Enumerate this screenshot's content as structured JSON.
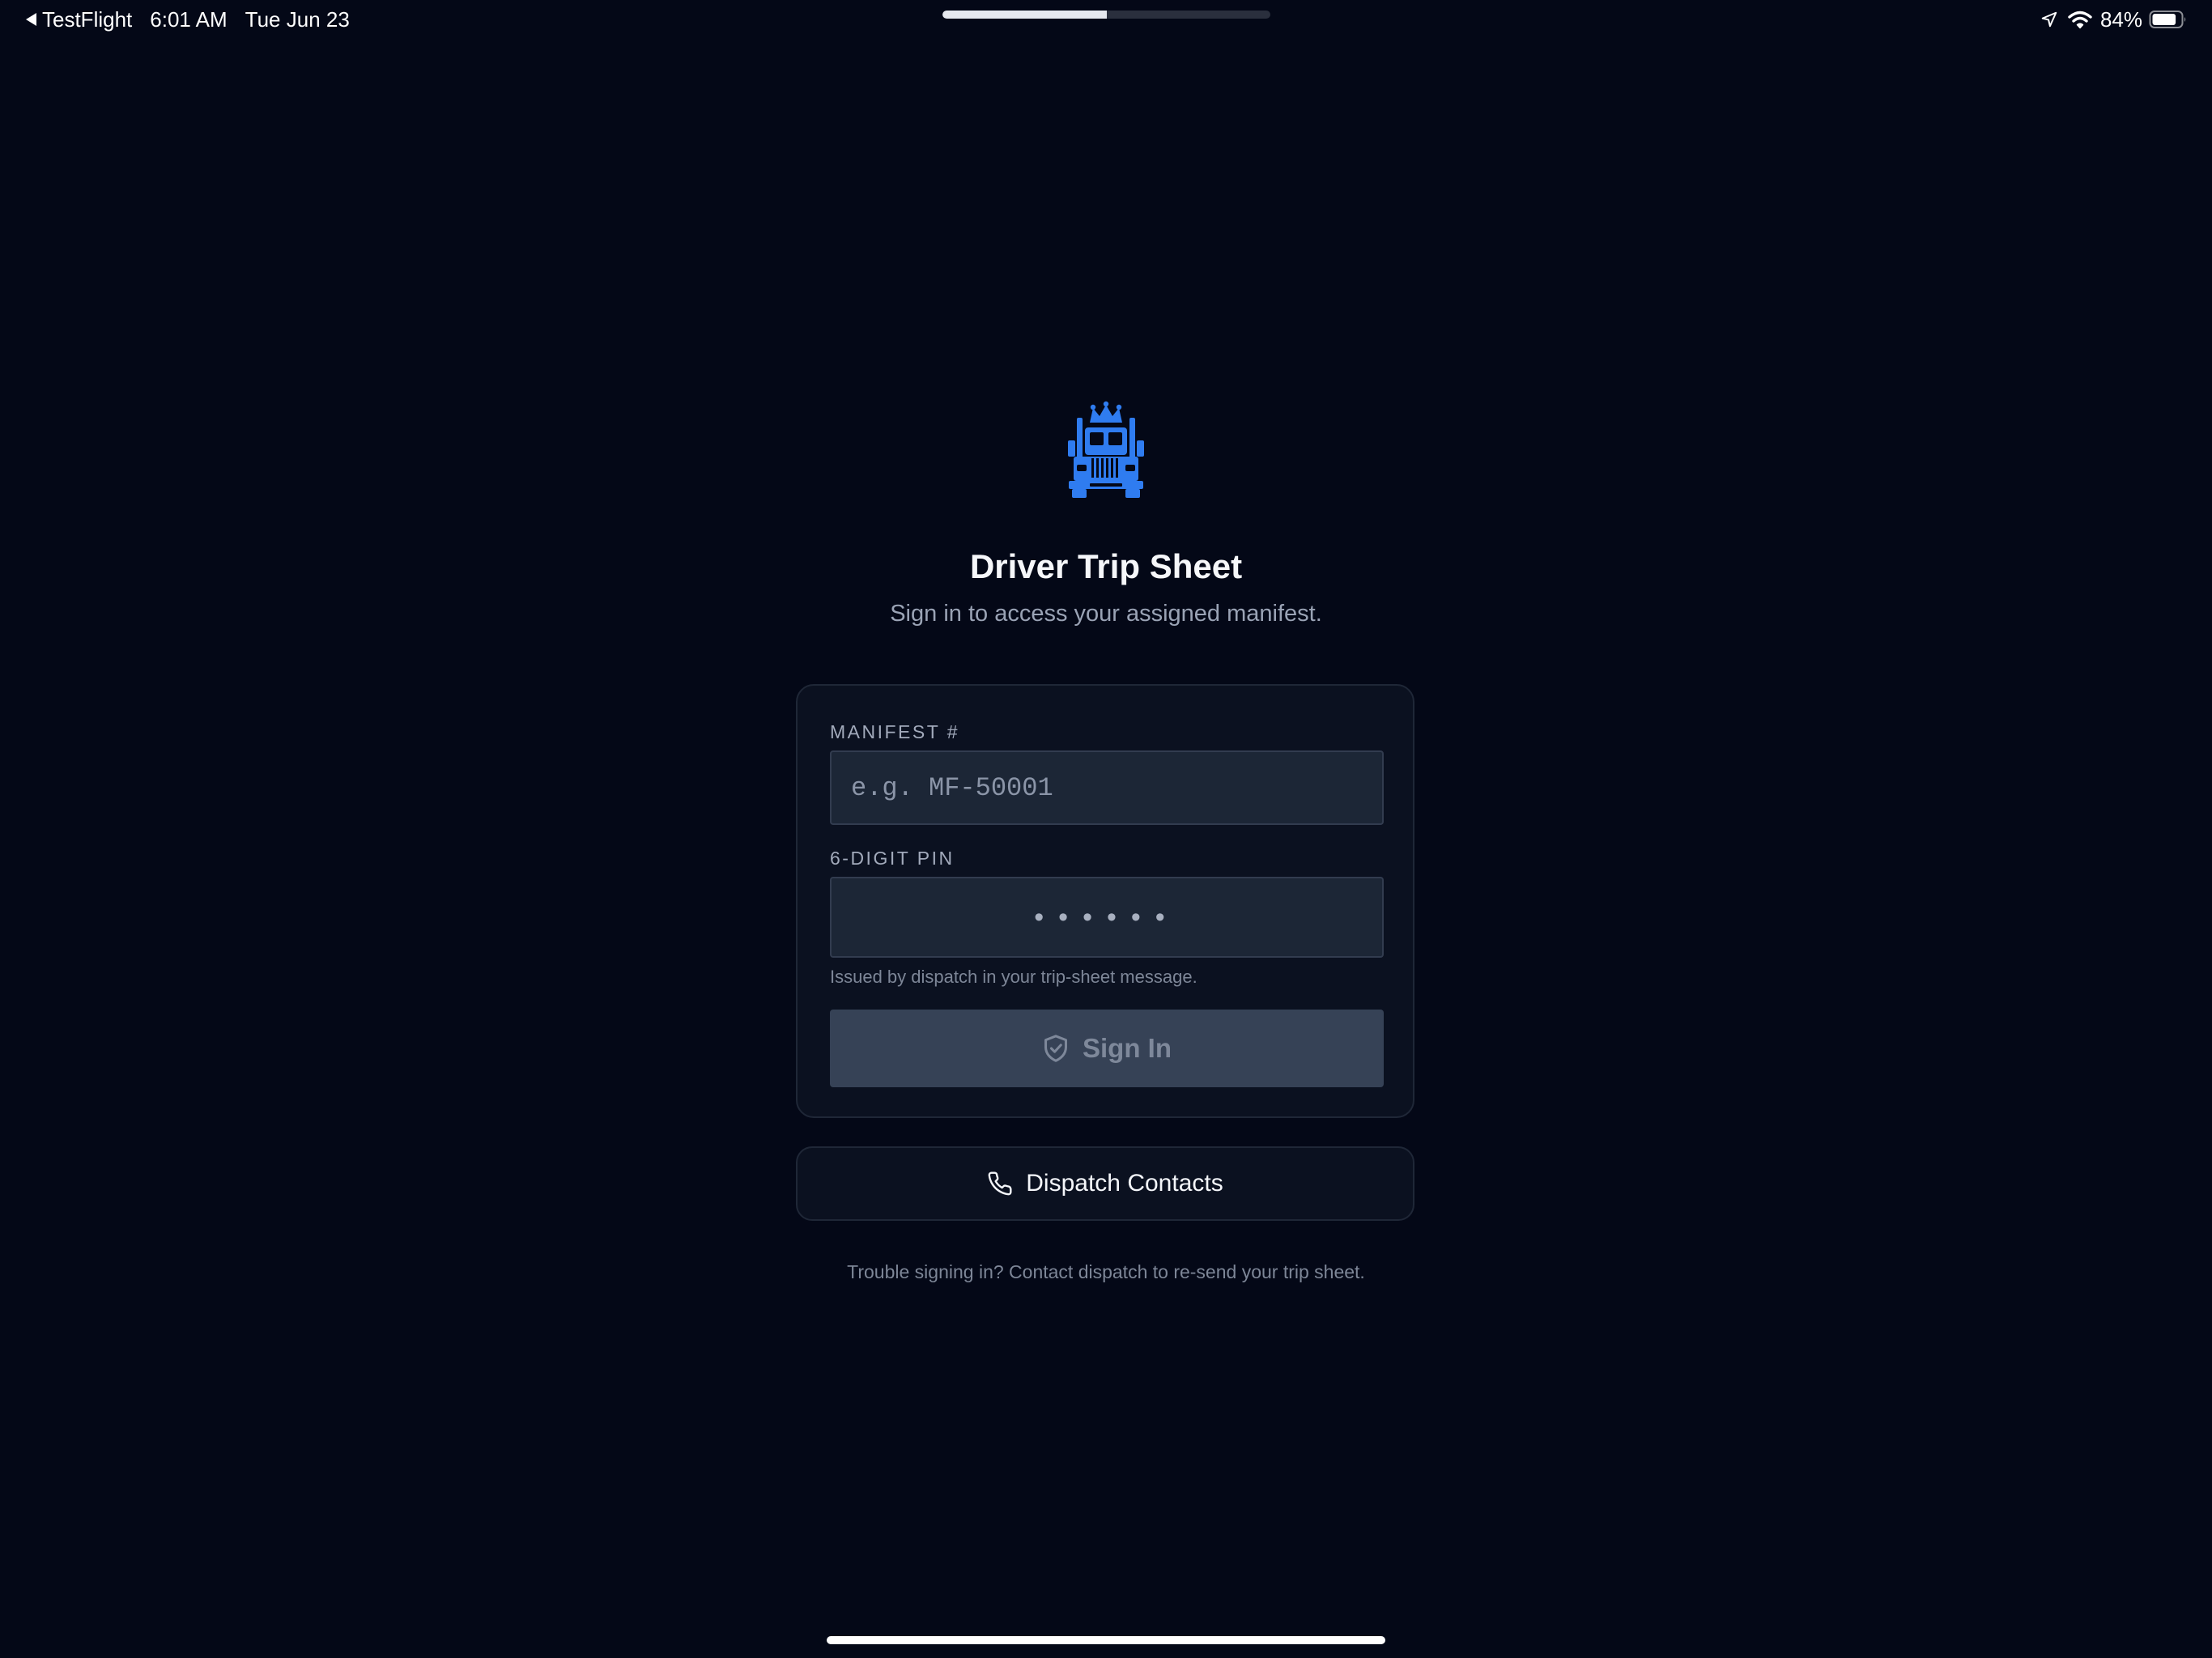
{
  "status_bar": {
    "back_app": "TestFlight",
    "time": "6:01 AM",
    "date": "Tue Jun 23",
    "battery_percent": "84%",
    "battery_level": 0.84,
    "page_progress": 0.5,
    "icons": [
      "location-arrow-icon",
      "wifi-icon",
      "battery-icon"
    ]
  },
  "header": {
    "logo_icon": "crowned-truck-icon",
    "title": "Driver Trip Sheet",
    "subtitle": "Sign in to access your assigned manifest."
  },
  "form": {
    "manifest_label": "MANIFEST #",
    "manifest_placeholder": "e.g. MF-50001",
    "manifest_value": "",
    "pin_label": "6-DIGIT PIN",
    "pin_placeholder": "••••••",
    "pin_value": "",
    "pin_hint": "Issued by dispatch in your trip-sheet message.",
    "signin_label": "Sign In",
    "signin_icon": "shield-check-icon",
    "signin_enabled": false
  },
  "dispatch": {
    "label": "Dispatch Contacts",
    "icon": "phone-icon"
  },
  "footer": {
    "text": "Trouble signing in? Contact dispatch to re-send your trip sheet."
  },
  "colors": {
    "background": "#040817",
    "card": "#0b1120",
    "accent": "#2f7cf0",
    "input": "#1c2636",
    "button_disabled": "#364256"
  }
}
